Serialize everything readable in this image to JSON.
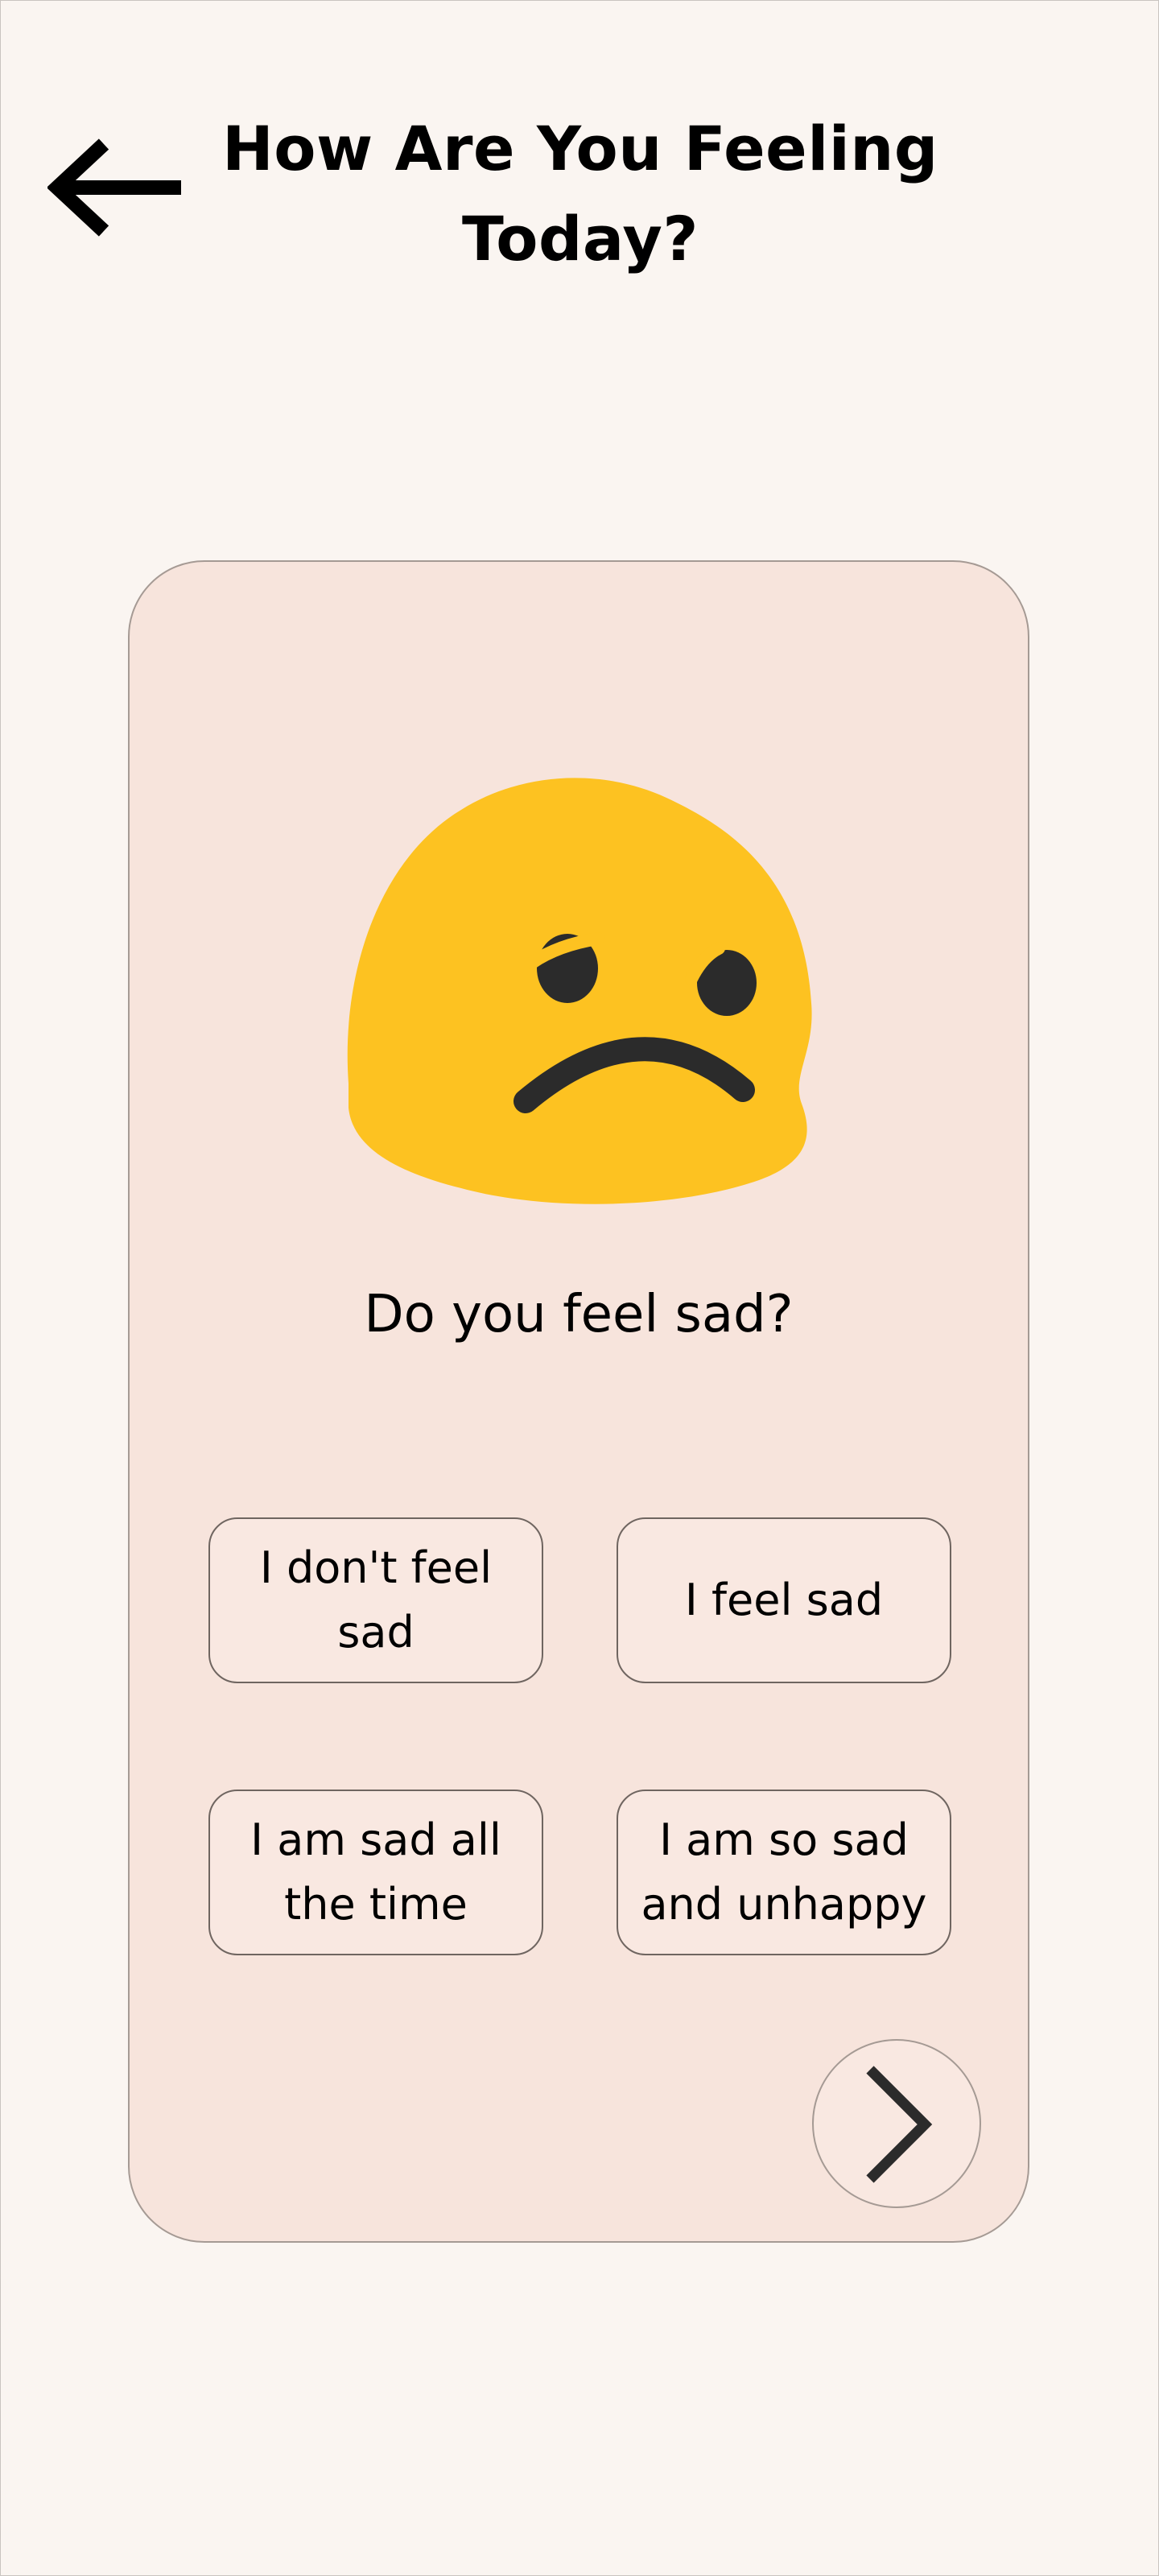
{
  "header": {
    "title_line1": "How Are You Feeling",
    "title_line2": "Today?",
    "back_icon": "arrow-left-icon"
  },
  "card": {
    "emoji_icon": "sad-face-emoji",
    "question": "Do you feel sad?",
    "options": [
      {
        "line1": "I don't feel",
        "line2": "sad"
      },
      {
        "line1": "I feel sad",
        "line2": ""
      },
      {
        "line1": "I am sad all",
        "line2": "the time"
      },
      {
        "line1": "I am so sad",
        "line2": "and unhappy"
      }
    ],
    "next_icon": "chevron-right-icon"
  },
  "colors": {
    "background": "#faf5f1",
    "card": "#f7e4dc",
    "option": "#f9e8e1",
    "emoji_yellow": "#fdc221",
    "emoji_features": "#2b2b2b"
  }
}
